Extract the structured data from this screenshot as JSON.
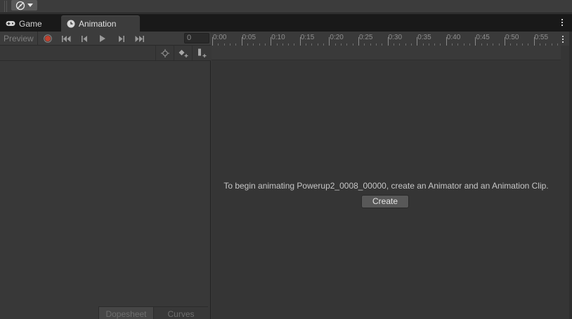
{
  "tabs": [
    {
      "label": "Game",
      "icon": "gamepad-icon"
    },
    {
      "label": "Animation",
      "icon": "clock-icon"
    }
  ],
  "toolbar": {
    "preview_label": "Preview",
    "frame_value": "0",
    "record_color": "#c0412f"
  },
  "timeline": {
    "ticks": [
      "0:00",
      "0:05",
      "0:10",
      "0:15",
      "0:20",
      "0:25",
      "0:30",
      "0:35",
      "0:40",
      "0:45",
      "0:50",
      "0:55"
    ]
  },
  "empty_state": {
    "message": "To begin animating Powerup2_0008_00000, create an Animator and an Animation Clip.",
    "button_label": "Create"
  },
  "bottom_tabs": {
    "dopesheet": "Dopesheet",
    "curves": "Curves"
  }
}
